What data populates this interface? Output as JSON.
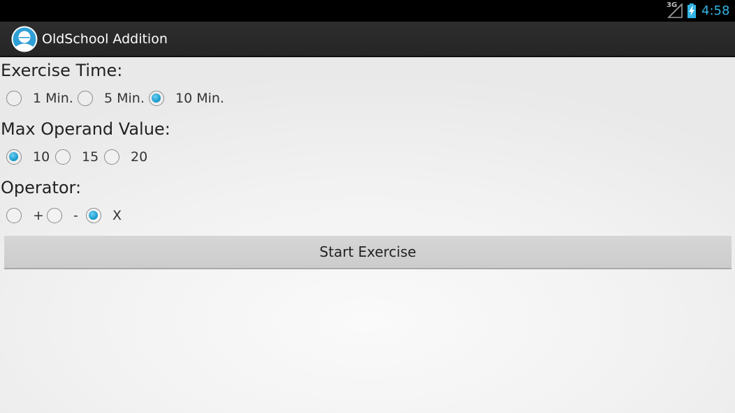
{
  "status_bar": {
    "network_type": "3G",
    "time": "4:58",
    "accent_color": "#33b5e5"
  },
  "action_bar": {
    "app_title": "OldSchool Addition",
    "app_icon": "face-icon"
  },
  "form": {
    "exercise_time": {
      "label": "Exercise Time:",
      "options": [
        {
          "label": "1 Min.",
          "checked": false
        },
        {
          "label": "5 Min.",
          "checked": false
        },
        {
          "label": "10 Min.",
          "checked": true
        }
      ]
    },
    "max_operand": {
      "label": "Max Operand Value:",
      "options": [
        {
          "label": "10",
          "checked": true
        },
        {
          "label": "15",
          "checked": false
        },
        {
          "label": "20",
          "checked": false
        }
      ]
    },
    "operator": {
      "label": "Operator:",
      "options": [
        {
          "label": "+",
          "checked": false
        },
        {
          "label": "-",
          "checked": false
        },
        {
          "label": "X",
          "checked": true
        }
      ]
    },
    "start_button_label": "Start Exercise"
  }
}
